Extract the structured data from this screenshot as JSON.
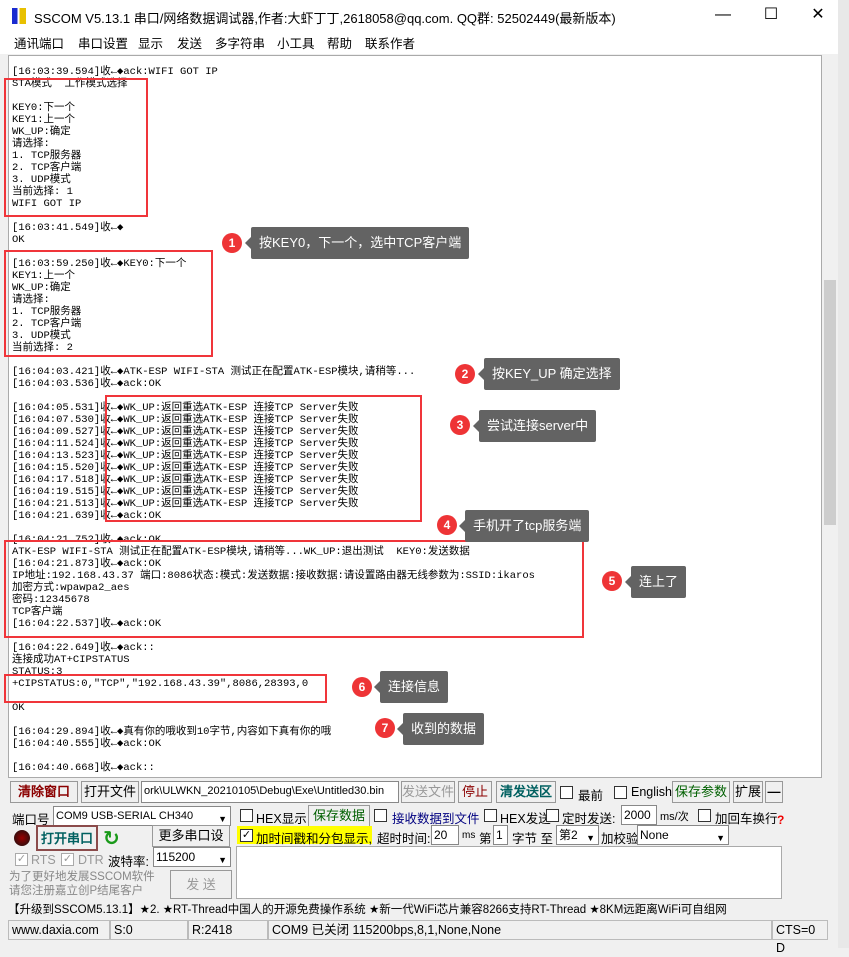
{
  "window": {
    "title": "SSCOM V5.13.1 串口/网络数据调试器,作者:大虾丁丁,2618058@qq.com. QQ群: 52502449(最新版本)",
    "minimize": "—",
    "maximize": "☐",
    "close": "✕"
  },
  "menu": [
    "通讯端口",
    "串口设置",
    "显示",
    "发送",
    "多字符串",
    "小工具",
    "帮助",
    "联系作者"
  ],
  "log_lines": [
    "[16:03:39.594]收←◆ack:WIFI GOT IP",
    "STA模式  工作模式选择",
    "",
    "KEY0:下一个",
    "KEY1:上一个",
    "WK_UP:确定",
    "请选择:",
    "1. TCP服务器",
    "2. TCP客户端",
    "3. UDP模式",
    "当前选择: 1",
    "WIFI GOT IP",
    "",
    "[16:03:41.549]收←◆",
    "OK",
    "",
    "[16:03:59.250]收←◆KEY0:下一个",
    "KEY1:上一个",
    "WK_UP:确定",
    "请选择:",
    "1. TCP服务器",
    "2. TCP客户端",
    "3. UDP模式",
    "当前选择: 2",
    "",
    "[16:04:03.421]收←◆ATK-ESP WIFI-STA 测试正在配置ATK-ESP模块,请稍等...",
    "[16:04:03.536]收←◆ack:OK",
    "",
    "[16:04:05.531]收←◆WK_UP:返回重选ATK-ESP 连接TCP Server失败",
    "[16:04:07.530]收←◆WK_UP:返回重选ATK-ESP 连接TCP Server失败",
    "[16:04:09.527]收←◆WK_UP:返回重选ATK-ESP 连接TCP Server失败",
    "[16:04:11.524]收←◆WK_UP:返回重选ATK-ESP 连接TCP Server失败",
    "[16:04:13.523]收←◆WK_UP:返回重选ATK-ESP 连接TCP Server失败",
    "[16:04:15.520]收←◆WK_UP:返回重选ATK-ESP 连接TCP Server失败",
    "[16:04:17.518]收←◆WK_UP:返回重选ATK-ESP 连接TCP Server失败",
    "[16:04:19.515]收←◆WK_UP:返回重选ATK-ESP 连接TCP Server失败",
    "[16:04:21.513]收←◆WK_UP:返回重选ATK-ESP 连接TCP Server失败",
    "[16:04:21.639]收←◆ack:OK",
    "",
    "[16:04:21.752]收←◆ack:OK",
    "ATK-ESP WIFI-STA 测试正在配置ATK-ESP模块,请稍等...WK_UP:退出测试  KEY0:发送数据",
    "[16:04:21.873]收←◆ack:OK",
    "IP地址:192.168.43.37 端口:8086状态:模式:发送数据:接收数据:请设置路由器无线参数为:SSID:ikaros",
    "加密方式:wpawpa2_aes",
    "密码:12345678",
    "TCP客户端",
    "[16:04:22.537]收←◆ack:OK",
    "",
    "[16:04:22.649]收←◆ack::",
    "连接成功AT+CIPSTATUS",
    "STATUS:3",
    "+CIPSTATUS:0,\"TCP\",\"192.168.43.39\",8086,28393,0",
    "",
    "OK",
    "",
    "[16:04:29.894]收←◆真有你的哦收到10字节,内容如下真有你的哦",
    "[16:04:40.555]收←◆ack:OK",
    "",
    "[16:04:40.668]收←◆ack::"
  ],
  "annotations": [
    {
      "num": "1",
      "text": "按KEY0，下一个，选中TCP客户端"
    },
    {
      "num": "2",
      "text": "按KEY_UP 确定选择"
    },
    {
      "num": "3",
      "text": "尝试连接server中"
    },
    {
      "num": "4",
      "text": "手机开了tcp服务端"
    },
    {
      "num": "5",
      "text": "连上了"
    },
    {
      "num": "6",
      "text": "连接信息"
    },
    {
      "num": "7",
      "text": "收到的数据"
    }
  ],
  "toolbar": {
    "clear": "清除窗口",
    "open_file": "打开文件",
    "file_path": "ork\\ULWKN_20210105\\Debug\\Exe\\Untitled30.bin",
    "send_file": "发送文件",
    "stop": "停止",
    "clear_send": "清发送区",
    "topmost": "最前",
    "english": "English",
    "save_params": "保存参数",
    "expand": "扩展",
    "collapse": "—"
  },
  "port": {
    "label": "端口号",
    "value": "COM9 USB-SERIAL CH340",
    "open": "打开串口",
    "more": "更多串口设置",
    "rts": "RTS",
    "dtr": "DTR",
    "baud_label": "波特率:",
    "baud": "115200",
    "promo": "为了更好地发展SSCOM软件\n请您注册嘉立创P结尾客户",
    "send": "发 送"
  },
  "options": {
    "hex_display": "HEX显示",
    "save_data": "保存数据",
    "recv_to_file": "接收数据到文件",
    "hex_send": "HEX发送",
    "timed_send": "定时发送:",
    "interval": "2000",
    "interval_unit": "ms/次",
    "add_crlf": "加回车换行",
    "timestamp": "加时间戳和分包显示,",
    "timeout_label": "超时时间:",
    "timeout": "20",
    "timeout_unit": "ms",
    "byte_from_label": "第",
    "byte_from": "1",
    "byte_label": "字节 至",
    "byte_to": "第2",
    "checksum_label": "加校验",
    "checksum": "None",
    "help": "?",
    "timestamp_checked": true
  },
  "ticker": "【升级到SSCOM5.13.1】★2. ★RT-Thread中国人的开源免费操作系统 ★新一代WiFi芯片兼容8266支持RT-Thread ★8KM远距离WiFi可自组网",
  "status": {
    "site": "www.daxia.com",
    "sent": "S:0",
    "recv": "R:2418",
    "port": "COM9 已关闭  115200bps,8,1,None,None",
    "cts": "CTS=0 D"
  },
  "colors": {
    "highlight_box": "#f0353a",
    "callout_bg": "#636363",
    "clear_button_text": "#8b0000",
    "open_port_text": "#006060",
    "timestamp_bg": "#ffff00"
  }
}
